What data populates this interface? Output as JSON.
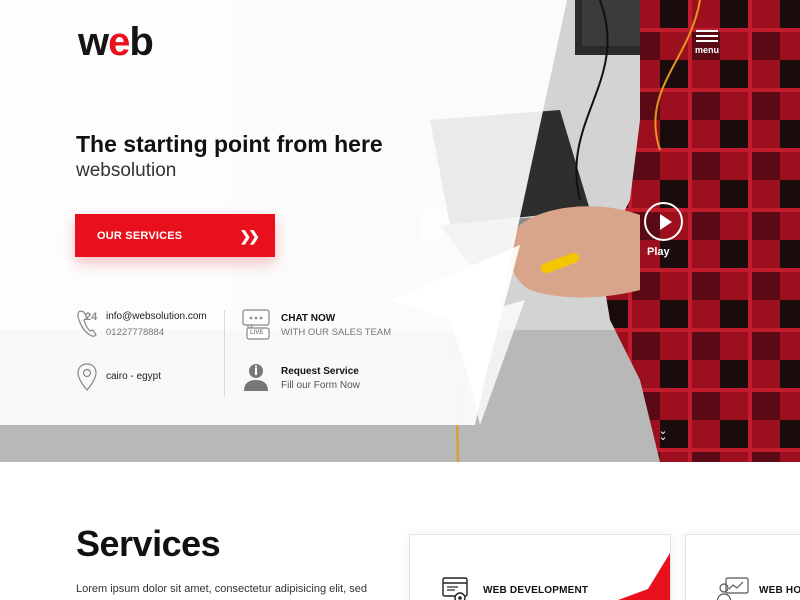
{
  "brand": {
    "logo_pre": "w",
    "logo_accent": "e",
    "logo_post": "b"
  },
  "nav": {
    "menu_label": "menu"
  },
  "hero": {
    "title": "The starting point from here",
    "subtitle": "websolution",
    "cta_label": "OUR SERVICES",
    "cta_icon": "double-chevron-right-icon",
    "play_label": "Play",
    "scroll_icon": "double-chevron-down-icon"
  },
  "contacts": {
    "phone": {
      "icon": "phone-24-icon",
      "badge": "24",
      "email": "info@websolution.com",
      "number": "01227778884"
    },
    "location": {
      "icon": "map-pin-icon",
      "text": "cairo - egypt"
    },
    "chat": {
      "icon": "live-chat-icon",
      "badge": "LIVE",
      "title": "CHAT NOW",
      "subtitle": "WITH OUR SALES TEAM"
    },
    "request": {
      "icon": "support-agent-icon",
      "title": "Request Service",
      "subtitle": "Fill our Form Now"
    }
  },
  "services": {
    "title": "Services",
    "description": "Lorem ipsum dolor sit amet, consectetur adipisicing elit, sed",
    "cards": [
      {
        "label": "WEB DEVELOPMENT",
        "icon": "web-development-icon"
      },
      {
        "label": "WEB HOS",
        "icon": "web-hosting-icon"
      }
    ]
  },
  "colors": {
    "accent": "#e8101c",
    "text": "#111111",
    "muted": "#777777"
  }
}
